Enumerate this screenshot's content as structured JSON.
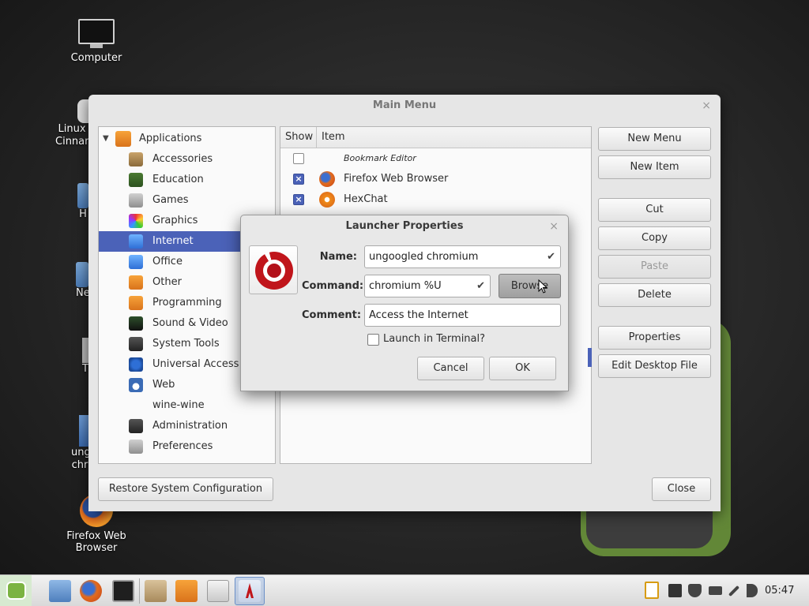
{
  "desktop": {
    "icons": [
      {
        "label": "Computer"
      },
      {
        "label": "Linux Cinnamon",
        "lines": [
          "Linux",
          "Cinnan"
        ]
      },
      {
        "label": "H"
      },
      {
        "label": "Ne"
      },
      {
        "label": "T"
      },
      {
        "label": "ungoogled chromium",
        "lines": [
          "ung",
          "chr"
        ]
      },
      {
        "label": "Firefox Web Browser",
        "lines": [
          "Firefox Web",
          "Browser"
        ]
      }
    ]
  },
  "main_menu": {
    "title": "Main Menu",
    "close_glyph": "×",
    "categories": [
      {
        "label": "Applications",
        "icon": "applications-icon",
        "color": "#f0902a"
      },
      {
        "label": "Accessories",
        "icon": "accessories-icon"
      },
      {
        "label": "Education",
        "icon": "education-icon"
      },
      {
        "label": "Games",
        "icon": "games-icon"
      },
      {
        "label": "Graphics",
        "icon": "graphics-icon"
      },
      {
        "label": "Internet",
        "icon": "internet-icon",
        "selected": true
      },
      {
        "label": "Office",
        "icon": "office-icon"
      },
      {
        "label": "Other",
        "icon": "other-icon"
      },
      {
        "label": "Programming",
        "icon": "programming-icon"
      },
      {
        "label": "Sound & Video",
        "icon": "sound-video-icon"
      },
      {
        "label": "System Tools",
        "icon": "system-tools-icon"
      },
      {
        "label": "Universal Access",
        "icon": "universal-access-icon"
      },
      {
        "label": "Web",
        "icon": "web-icon"
      },
      {
        "label": "wine-wine",
        "icon": ""
      },
      {
        "label": "Administration",
        "icon": "administration-icon"
      },
      {
        "label": "Preferences",
        "icon": "preferences-icon"
      }
    ],
    "item_columns": {
      "show": "Show",
      "item": "Item"
    },
    "items": [
      {
        "label": "Bookmark Editor",
        "checked": false
      },
      {
        "label": "Firefox Web Browser",
        "checked": true
      },
      {
        "label": "HexChat",
        "checked": true
      }
    ],
    "buttons": {
      "new_menu": "New Menu",
      "new_item": "New Item",
      "cut": "Cut",
      "copy": "Copy",
      "paste": "Paste",
      "delete": "Delete",
      "properties": "Properties",
      "edit_desktop_file": "Edit Desktop File",
      "restore": "Restore System Configuration",
      "close": "Close"
    }
  },
  "launcher_dialog": {
    "title": "Launcher Properties",
    "close_glyph": "×",
    "name_label": "Name:",
    "name_value": "ungoogled chromium",
    "command_label": "Command:",
    "command_value": "chromium %U",
    "browse_label": "Browse",
    "comment_label": "Comment:",
    "comment_value": "Access the Internet",
    "terminal_label": "Launch in Terminal?",
    "terminal_checked": false,
    "cancel_label": "Cancel",
    "ok_label": "OK"
  },
  "taskbar": {
    "clock": "05:47"
  },
  "colors": {
    "selection": "#4b62b8",
    "chromium_red": "#c0151b",
    "mint_green": "#7bb342"
  }
}
